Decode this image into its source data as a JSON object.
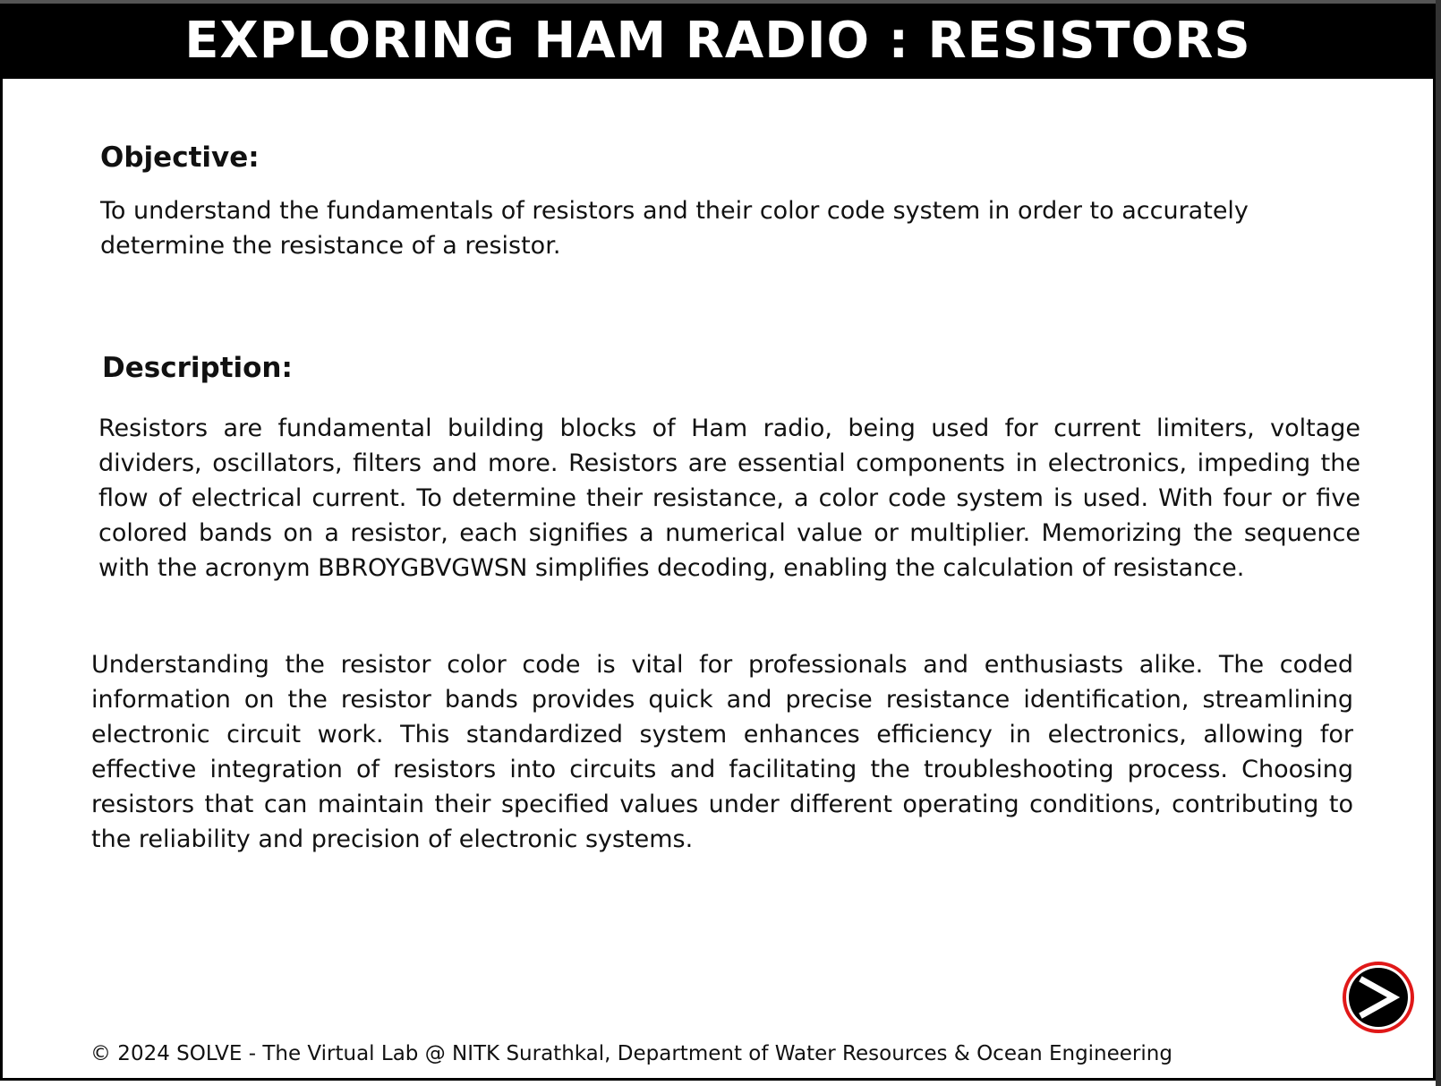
{
  "header": {
    "title": "EXPLORING HAM RADIO : RESISTORS"
  },
  "objective": {
    "heading": "Objective:",
    "text": "To understand the fundamentals of resistors and their color code system in order to accurately determine the resistance of a resistor."
  },
  "description": {
    "heading": "Description:",
    "paragraph1": "Resistors are fundamental building blocks of Ham radio, being used for current limiters, voltage dividers, oscillators, filters and more. Resistors are essential components in electronics, impeding the flow of electrical current. To determine their resistance, a color code system is used. With four or five colored bands on a resistor, each signifies a numerical value or multiplier. Memorizing the sequence with the acronym BBROYGBVGWSN simplifies decoding, enabling the calculation of resistance.",
    "paragraph2": "Understanding the resistor color code is vital for professionals and enthusiasts alike. The coded information on the resistor bands provides quick and precise resistance identification, streamlining electronic circuit work. This standardized system enhances efficiency in electronics, allowing for effective integration of resistors into circuits and facilitating the troubleshooting process. Choosing resistors that can maintain their specified values under different operating conditions, contributing to the reliability and precision of electronic systems."
  },
  "footer": {
    "text": "© 2024 SOLVE - The Virtual Lab @ NITK Surathkal, Department of Water Resources & Ocean Engineering"
  },
  "next_button": {
    "icon": "arrow-right-icon",
    "ring_color": "#e01818"
  }
}
